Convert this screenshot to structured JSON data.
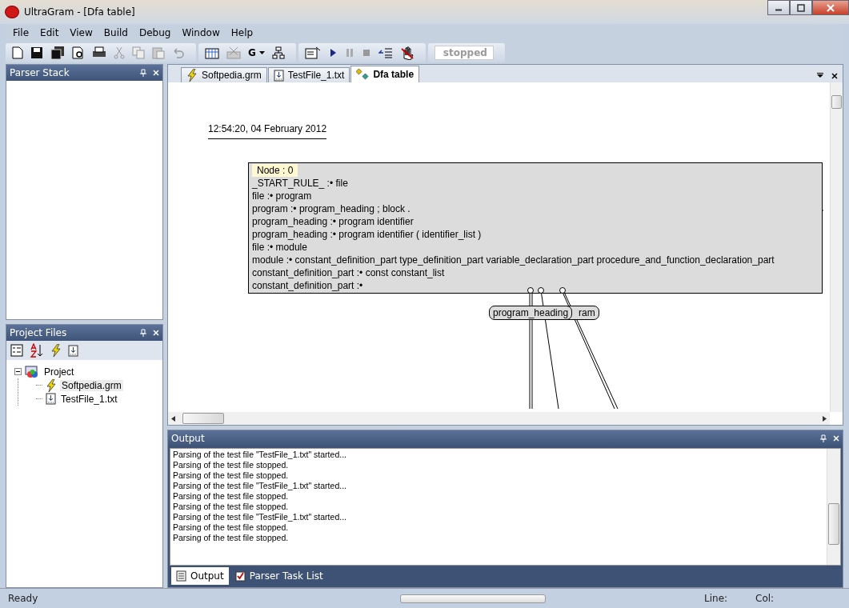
{
  "window": {
    "title": "UltraGram - [Dfa table]"
  },
  "menu": [
    "File",
    "Edit",
    "View",
    "Build",
    "Debug",
    "Window",
    "Help"
  ],
  "toolbar": {
    "build_letter": "G",
    "state": "stopped"
  },
  "parser_stack": {
    "title": "Parser Stack"
  },
  "project_files": {
    "title": "Project Files",
    "tree": [
      {
        "label": "Project",
        "kind": "project",
        "expanded": true,
        "selected": false,
        "children": [
          {
            "label": "Softpedia.grm",
            "kind": "grammar",
            "selected": true
          },
          {
            "label": "TestFile_1.txt",
            "kind": "text",
            "selected": false
          }
        ]
      }
    ]
  },
  "tabs": [
    {
      "label": "Softpedia.grm",
      "kind": "grammar",
      "selected": false
    },
    {
      "label": "TestFile_1.txt",
      "kind": "text",
      "selected": false
    },
    {
      "label": "Dfa table",
      "kind": "table",
      "selected": true
    }
  ],
  "canvas": {
    "timestamp": "12:54:20,  04 February 2012",
    "node": {
      "title": "Node : 0",
      "rules": [
        "_START_RULE_ :• file",
        "file :• program",
        "program :• program_heading ; block .",
        "program_heading :• program identifier",
        "program_heading :• program identifier ( identifier_list )",
        "file :• module",
        "module :• constant_definition_part type_definition_part variable_declaration_part procedure_and_function_declaration_part",
        "constant_definition_part :• const constant_list",
        "constant_definition_part :•"
      ]
    },
    "edge_labels": [
      "program_heading",
      "ram"
    ]
  },
  "output": {
    "title": "Output",
    "lines": [
      "Parsing of the test file \"TestFile_1.txt\" started...",
      "Parsing of the test file stopped.",
      "Parsing of the test file stopped.",
      "Parsing of the test file \"TestFile_1.txt\" started...",
      "Parsing of the test file stopped.",
      "Parsing of the test file stopped.",
      "Parsing of the test file \"TestFile_1.txt\" started...",
      "Parsing of the test file stopped.",
      "Parsing of the test file stopped."
    ]
  },
  "bottom_tabs": [
    {
      "label": "Output",
      "kind": "output",
      "selected": true
    },
    {
      "label": "Parser Task List",
      "kind": "tasks",
      "selected": false
    }
  ],
  "status_bar": {
    "text": "Ready",
    "progress": {
      "level": 0
    },
    "line_label": "Line:",
    "col_label": "Col:"
  }
}
